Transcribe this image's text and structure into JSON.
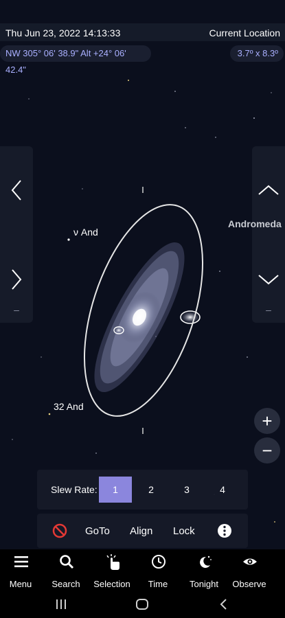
{
  "status": {
    "datetime": "Thu Jun 23, 2022  14:13:33",
    "location": "Current Location"
  },
  "info": {
    "coords": "NW 305° 06' 38.9\" Alt +24° 06' 42.4\"",
    "fov": "3.7º x  8.3º"
  },
  "sky": {
    "labels": {
      "nu_and": "ν And",
      "and_32": "32 And",
      "constellation": "Andromeda"
    }
  },
  "side_panels": {
    "left_dash": "–",
    "right_dash": "–"
  },
  "zoom": {
    "in": "+",
    "out": "−"
  },
  "slew": {
    "label": "Slew Rate:",
    "options": [
      "1",
      "2",
      "3",
      "4"
    ],
    "selected": "1"
  },
  "actions": {
    "goto": "GoTo",
    "align": "Align",
    "lock": "Lock"
  },
  "nav": {
    "items": [
      {
        "label": "Menu",
        "icon": "menu-icon"
      },
      {
        "label": "Search",
        "icon": "search-icon"
      },
      {
        "label": "Selection",
        "icon": "selection-icon"
      },
      {
        "label": "Time",
        "icon": "clock-icon"
      },
      {
        "label": "Tonight",
        "icon": "moon-stars-icon"
      },
      {
        "label": "Observe",
        "icon": "eye-icon"
      }
    ]
  },
  "colors": {
    "background": "#0b0f1d",
    "accent": "#8b86dd",
    "info_text": "#aab0ff",
    "stop_red": "#e53935"
  }
}
